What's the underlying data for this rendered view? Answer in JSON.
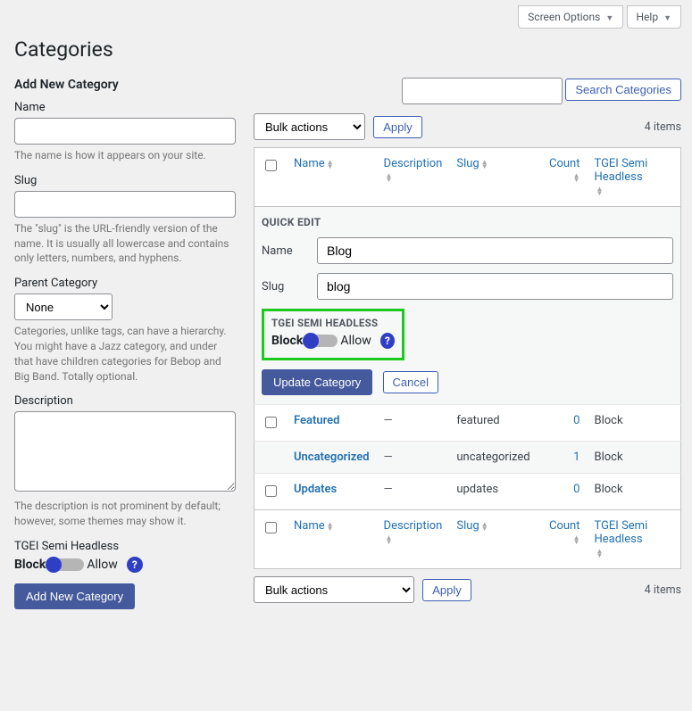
{
  "top": {
    "screen_options": "Screen Options",
    "help": "Help"
  },
  "page_title": "Categories",
  "search": {
    "button": "Search Categories"
  },
  "form": {
    "heading": "Add New Category",
    "name_label": "Name",
    "name_help": "The name is how it appears on your site.",
    "slug_label": "Slug",
    "slug_help": "The \"slug\" is the URL-friendly version of the name. It is usually all lowercase and contains only letters, numbers, and hyphens.",
    "parent_label": "Parent Category",
    "parent_value": "None",
    "parent_help": "Categories, unlike tags, can have a hierarchy. You might have a Jazz category, and under that have children categories for Bebop and Big Band. Totally optional.",
    "desc_label": "Description",
    "desc_help": "The description is not prominent by default; however, some themes may show it.",
    "tgei_label": "TGEI Semi Headless",
    "toggle_block": "Block",
    "toggle_allow": "Allow",
    "submit": "Add New Category"
  },
  "bulk": {
    "label": "Bulk actions",
    "apply": "Apply"
  },
  "items_count": "4 items",
  "cols": {
    "name": "Name",
    "description": "Description",
    "slug": "Slug",
    "count": "Count",
    "tgei": "TGEI Semi Headless"
  },
  "quick_edit": {
    "heading": "QUICK EDIT",
    "name_label": "Name",
    "name_value": "Blog",
    "slug_label": "Slug",
    "slug_value": "blog",
    "tgei_heading": "TGEI SEMI HEADLESS",
    "toggle_block": "Block",
    "toggle_allow": "Allow",
    "update": "Update Category",
    "cancel": "Cancel"
  },
  "rows": [
    {
      "name": "Featured",
      "desc": "—",
      "slug": "featured",
      "count": "0",
      "tgei": "Block",
      "has_cb": true,
      "striped": false
    },
    {
      "name": "Uncategorized",
      "desc": "—",
      "slug": "uncategorized",
      "count": "1",
      "tgei": "Block",
      "has_cb": false,
      "striped": true
    },
    {
      "name": "Updates",
      "desc": "—",
      "slug": "updates",
      "count": "0",
      "tgei": "Block",
      "has_cb": true,
      "striped": false
    }
  ]
}
